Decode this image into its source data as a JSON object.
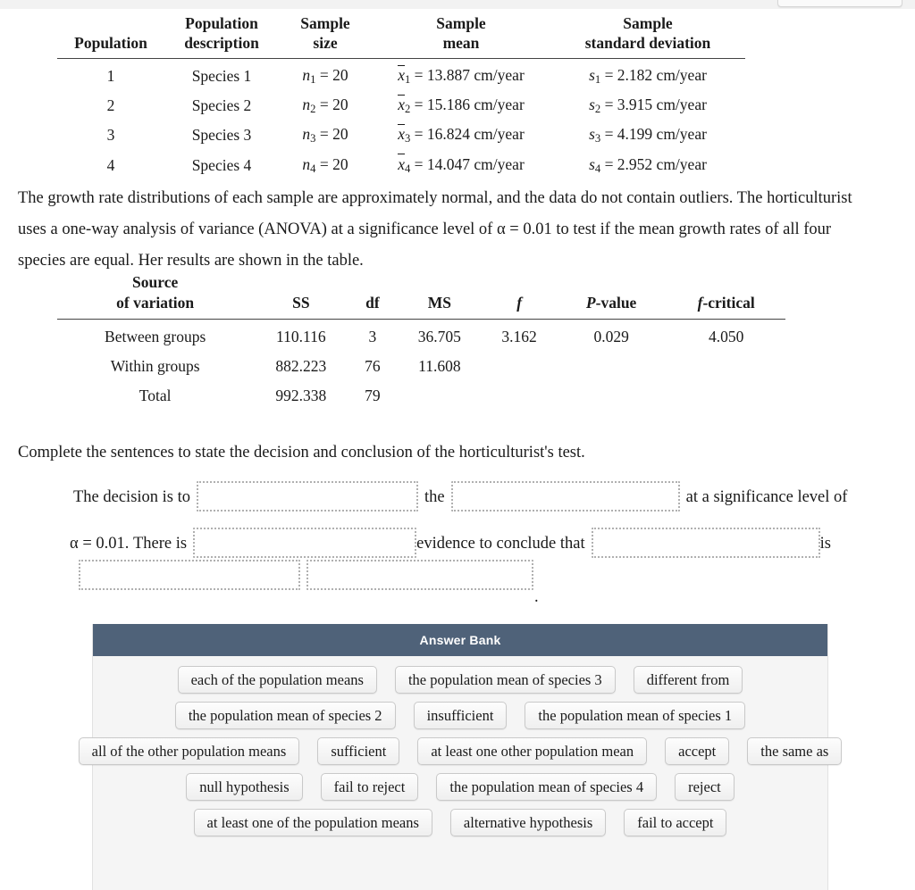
{
  "stats_table": {
    "headers": [
      {
        "line1": "Population",
        "line2": ""
      },
      {
        "line1": "Population",
        "line2": "description"
      },
      {
        "line1": "Sample",
        "line2": "size"
      },
      {
        "line1": "Sample",
        "line2": "mean"
      },
      {
        "line1": "Sample",
        "line2": "standard deviation"
      }
    ],
    "rows": [
      {
        "population": "1",
        "description": "Species 1",
        "n_sub": "1",
        "n_value": "= 20",
        "mean_sub": "1",
        "mean_value": "= 13.887 cm/year",
        "sd_sub": "1",
        "sd_value": "= 2.182 cm/year"
      },
      {
        "population": "2",
        "description": "Species 2",
        "n_sub": "2",
        "n_value": "= 20",
        "mean_sub": "2",
        "mean_value": "= 15.186 cm/year",
        "sd_sub": "2",
        "sd_value": "= 3.915 cm/year"
      },
      {
        "population": "3",
        "description": "Species 3",
        "n_sub": "3",
        "n_value": "= 20",
        "mean_sub": "3",
        "mean_value": "= 16.824 cm/year",
        "sd_sub": "3",
        "sd_value": "= 4.199 cm/year"
      },
      {
        "population": "4",
        "description": "Species 4",
        "n_sub": "4",
        "n_value": "= 20",
        "mean_sub": "4",
        "mean_value": "= 14.047 cm/year",
        "sd_sub": "4",
        "sd_value": "= 2.952 cm/year"
      }
    ]
  },
  "paragraph": {
    "line1": "The growth rate distributions of each sample are approximately normal, and the data do not contain outliers. The horticulturist",
    "line2": "uses a one-way analysis of variance (ANOVA) at a significance level of α = 0.01 to test if the mean growth rates of all four",
    "line3": "species are equal. Her results are shown in the table."
  },
  "anova_table": {
    "headers": [
      {
        "line1": "Source",
        "line2": "of variation"
      },
      {
        "line1": "SS",
        "line2": ""
      },
      {
        "line1": "df",
        "line2": ""
      },
      {
        "line1": "MS",
        "line2": ""
      },
      {
        "line1": "f",
        "line2": ""
      },
      {
        "line1": "P",
        "line1_suffix": "-value",
        "line2": ""
      },
      {
        "line1": "f",
        "line1_suffix": "-critical",
        "line2": ""
      }
    ],
    "header_labels": {
      "source": "Source",
      "of_variation": "of variation",
      "ss": "SS",
      "df": "df",
      "ms": "MS",
      "f": "f",
      "p_value_italic": "P",
      "p_value_rest": "-value",
      "f_critical_italic": "f",
      "f_critical_rest": "-critical"
    },
    "rows": [
      {
        "source": "Between groups",
        "ss": "110.116",
        "df": "3",
        "ms": "36.705",
        "f": "3.162",
        "p_value": "0.029",
        "f_critical": "4.050"
      },
      {
        "source": "Within groups",
        "ss": "882.223",
        "df": "76",
        "ms": "11.608",
        "f": "",
        "p_value": "",
        "f_critical": ""
      },
      {
        "source": "Total",
        "ss": "992.338",
        "df": "79",
        "ms": "",
        "f": "",
        "p_value": "",
        "f_critical": ""
      }
    ]
  },
  "prompt": "Complete the sentences to state the decision and conclusion of the horticulturist's test.",
  "sentence": {
    "part1": "The decision is to",
    "part2": "the",
    "part3": "at a significance level of",
    "part4_alpha": "α = 0.01. There is",
    "part5": "evidence to conclude that",
    "part6": "is",
    "trailing_period": "."
  },
  "answer_bank": {
    "title": "Answer Bank",
    "rows": [
      [
        "each of the population means",
        "the population mean of species 3",
        "different from"
      ],
      [
        "the population mean of species 2",
        "insufficient",
        "the population mean of species 1"
      ],
      [
        "all of the other population means",
        "sufficient",
        "at least one other population mean",
        "accept",
        "the same as"
      ],
      [
        "null hypothesis",
        "fail to reject",
        "the population mean of species 4",
        "reject"
      ],
      [
        "at least one of the population means",
        "alternative hypothesis",
        "fail to accept"
      ]
    ]
  },
  "colors": {
    "answer_bank_header": "#4f6279",
    "answer_bank_body": "#f5f5f5",
    "chip_border": "#c9c9c9",
    "dropzone_border": "#b0b0b0",
    "text": "#1a1a1a"
  }
}
